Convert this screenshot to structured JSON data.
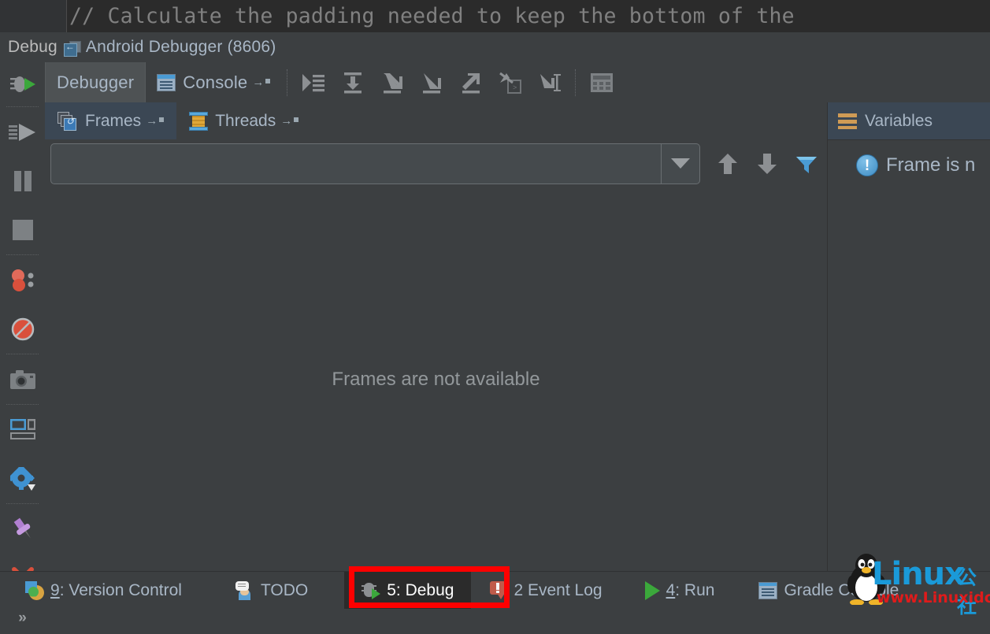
{
  "editor": {
    "code_line": "// Calculate the padding needed to keep the bottom of the"
  },
  "debug_header": {
    "label": "Debug",
    "restart_icon": "rerun-icon",
    "session_title": "Android Debugger (8606)"
  },
  "left_rail": {
    "items": [
      {
        "name": "debug-session-icon",
        "label": "Debug Session"
      },
      {
        "name": "resume-program-button",
        "label": "Resume Program"
      },
      {
        "name": "pause-program-button",
        "label": "Pause Program"
      },
      {
        "name": "stop-button",
        "label": "Stop"
      },
      {
        "name": "view-breakpoints-button",
        "label": "View Breakpoints"
      },
      {
        "name": "mute-breakpoints-button",
        "label": "Mute Breakpoints"
      },
      {
        "name": "screenshot-button",
        "label": "Screen Capture"
      },
      {
        "name": "restore-layout-button",
        "label": "Restore Layout"
      },
      {
        "name": "settings-button",
        "label": "Settings"
      },
      {
        "name": "pin-tab-button",
        "label": "Pin Tab"
      },
      {
        "name": "close-button",
        "label": "Close"
      },
      {
        "name": "more-button",
        "label": "»"
      }
    ]
  },
  "debug_tabs": {
    "tabs": [
      {
        "label": "Debugger",
        "icon": "none",
        "selected": true,
        "pinned": false
      },
      {
        "label": "Console",
        "icon": "console-icon",
        "selected": false,
        "pinned": true
      }
    ],
    "toolbar_buttons": [
      {
        "name": "show-execution-point-button",
        "label": "Show Execution Point"
      },
      {
        "name": "step-over-button",
        "label": "Step Over"
      },
      {
        "name": "step-into-button",
        "label": "Step Into"
      },
      {
        "name": "force-step-into-button",
        "label": "Force Step Into"
      },
      {
        "name": "step-out-button",
        "label": "Step Out"
      },
      {
        "name": "drop-frame-button",
        "label": "Drop Frame"
      },
      {
        "name": "run-to-cursor-button",
        "label": "Run to Cursor"
      },
      {
        "name": "evaluate-expression-button",
        "label": "Evaluate Expression"
      }
    ]
  },
  "frames_panel": {
    "tabs": [
      {
        "label": "Frames",
        "selected": true,
        "pinned": true
      },
      {
        "label": "Threads",
        "selected": false,
        "pinned": true
      }
    ],
    "thread_combo": {
      "value": "",
      "placeholder": ""
    },
    "combo_tools": [
      {
        "name": "move-up-button",
        "label": "Up"
      },
      {
        "name": "move-down-button",
        "label": "Down"
      },
      {
        "name": "filter-button",
        "label": "Filter"
      }
    ],
    "empty_message": "Frames are not available"
  },
  "variables_panel": {
    "tab_label": "Variables",
    "message": "Frame is n"
  },
  "status_bar": {
    "items": [
      {
        "name": "status-version-control",
        "mnemonic": "9",
        "label": ": Version Control",
        "icon": "vcs-icon",
        "active": false
      },
      {
        "name": "status-todo",
        "mnemonic": "",
        "label": "TODO",
        "icon": "todo-icon",
        "active": false
      },
      {
        "name": "status-debug",
        "mnemonic": "",
        "label": "5: Debug",
        "icon": "bug-icon",
        "active": true
      },
      {
        "name": "status-event-log",
        "mnemonic": "",
        "label": "2 Event Log",
        "icon": "event-log-icon",
        "active": false
      },
      {
        "name": "status-run",
        "mnemonic": "4",
        "label": ": Run",
        "icon": "run-icon",
        "active": false
      },
      {
        "name": "status-gradle-console",
        "mnemonic": "",
        "label": "Gradle Console",
        "icon": "gradle-icon",
        "active": false
      }
    ]
  },
  "annotation": {
    "name": "red-highlight-box",
    "color": "#fe0000",
    "targets": "status-debug"
  },
  "watermark": {
    "brand": "Linux",
    "brand_cn": "公社",
    "url": "www.Linuxidc.com",
    "brand_color": "#1a9ad9",
    "url_color": "#e01b1b"
  },
  "colors": {
    "background": "#3c3f41",
    "editor_background": "#2b2b2b",
    "text": "#a9b7c6",
    "selected_tab": "#3b4754",
    "accent_blue": "#4a9bd4"
  }
}
